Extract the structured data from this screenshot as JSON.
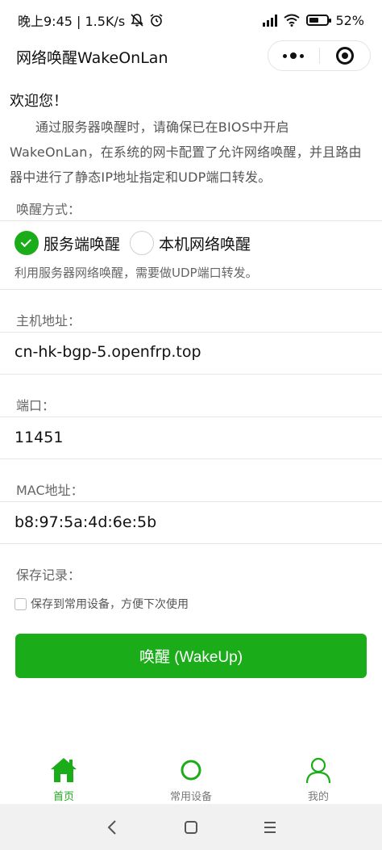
{
  "status_bar": {
    "time_speed": "晚上9:45 | 1.5K/s",
    "battery": "52%"
  },
  "nav": {
    "title": "网络唤醒WakeOnLan"
  },
  "welcome": {
    "heading": "欢迎您！",
    "body": "通过服务器唤醒时，请确保已在BIOS中开启WakeOnLan，在系统的网卡配置了允许网络唤醒，并且路由器中进行了静态IP地址指定和UDP端口转发。"
  },
  "wake_mode": {
    "label": "唤醒方式：",
    "options": [
      "服务端唤醒",
      "本机网络唤醒"
    ],
    "selected": "服务端唤醒",
    "hint": "利用服务器网络唤醒，需要做UDP端口转发。"
  },
  "host": {
    "label": "主机地址：",
    "value": "cn-hk-bgp-5.openfrp.top"
  },
  "port": {
    "label": "端口：",
    "value": "11451"
  },
  "mac": {
    "label": "MAC地址：",
    "value": "b8:97:5a:4d:6e:5b"
  },
  "save": {
    "label": "保存记录：",
    "checkbox_label": "保存到常用设备，方便下次使用",
    "checked": false
  },
  "wake_button": {
    "label": "唤醒 (WakeUp)"
  },
  "tabs": [
    {
      "label": "首页",
      "icon": "home-icon",
      "active": true
    },
    {
      "label": "常用设备",
      "icon": "circle-icon",
      "active": false
    },
    {
      "label": "我的",
      "icon": "user-icon",
      "active": false
    }
  ],
  "colors": {
    "accent": "#1aad19",
    "hint_text": "#666666"
  }
}
